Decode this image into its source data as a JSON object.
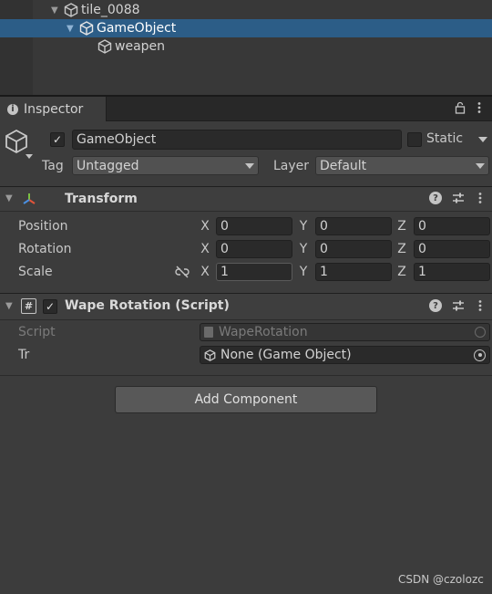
{
  "hierarchy": {
    "items": [
      {
        "label": "tile_0088"
      },
      {
        "label": "GameObject"
      },
      {
        "label": "weapen"
      }
    ]
  },
  "inspector": {
    "tab_label": "Inspector",
    "object": {
      "name": "GameObject",
      "active": true,
      "static_label": "Static",
      "tag_label": "Tag",
      "tag_value": "Untagged",
      "layer_label": "Layer",
      "layer_value": "Default"
    },
    "transform": {
      "title": "Transform",
      "rows": [
        {
          "label": "Position",
          "x": "0",
          "y": "0",
          "z": "0"
        },
        {
          "label": "Rotation",
          "x": "0",
          "y": "0",
          "z": "0"
        },
        {
          "label": "Scale",
          "x": "1",
          "y": "1",
          "z": "1"
        }
      ],
      "axis": {
        "x": "X",
        "y": "Y",
        "z": "Z"
      }
    },
    "script_component": {
      "title": "Wape Rotation (Script)",
      "enabled": true,
      "script_label": "Script",
      "script_value": "WapeRotation",
      "tr_label": "Tr",
      "tr_value": "None (Game Object)"
    },
    "add_component_label": "Add Component"
  },
  "watermark": "CSDN @czolozc",
  "colors": {
    "selection": "#2c5d87",
    "panel": "#3c3c3c",
    "field": "#2a2a2a"
  }
}
